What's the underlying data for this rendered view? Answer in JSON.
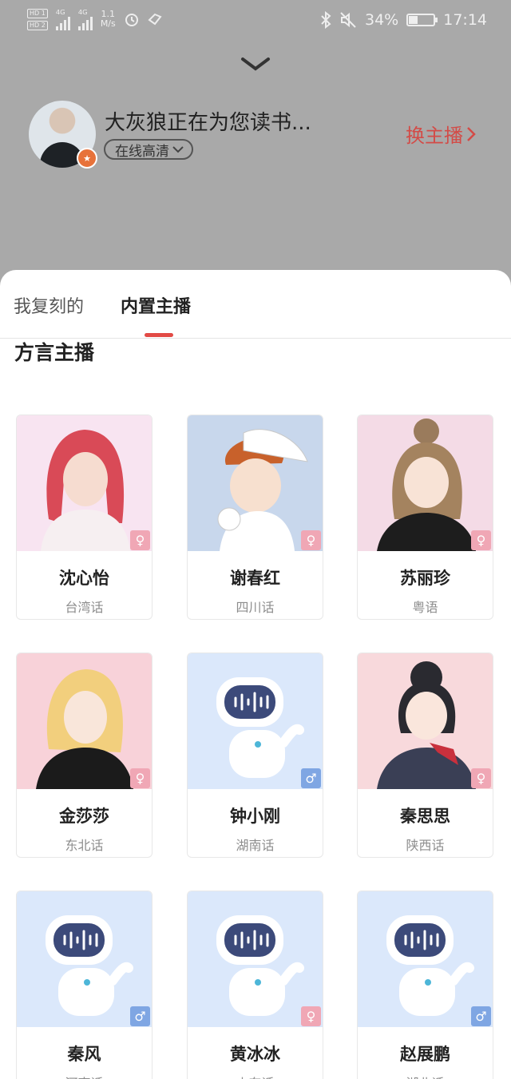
{
  "status_bar": {
    "sim1": "HD 1",
    "sim2": "HD 2",
    "net1": "4G",
    "net2": "4G",
    "speed_value": "1.1",
    "speed_unit": "M/s",
    "battery": "34%",
    "time": "17:14"
  },
  "reader": {
    "title": "大灰狼正在为您读书...",
    "quality": "在线高清",
    "switch_anchor": "换主播"
  },
  "tabs": [
    "我复刻的",
    "内置主播"
  ],
  "active_tab": 1,
  "section": {
    "title": "方言主播"
  },
  "anchors": [
    {
      "name": "沈心怡",
      "dialect": "台湾话",
      "gender": "female",
      "gender_symbol": "♀"
    },
    {
      "name": "谢春红",
      "dialect": "四川话",
      "gender": "female",
      "gender_symbol": "♀"
    },
    {
      "name": "苏丽珍",
      "dialect": "粤语",
      "gender": "female",
      "gender_symbol": "♀"
    },
    {
      "name": "金莎莎",
      "dialect": "东北话",
      "gender": "female",
      "gender_symbol": "♀"
    },
    {
      "name": "钟小刚",
      "dialect": "湖南话",
      "gender": "male",
      "gender_symbol": "♂"
    },
    {
      "name": "秦思思",
      "dialect": "陕西话",
      "gender": "female",
      "gender_symbol": "♀"
    },
    {
      "name": "秦风",
      "dialect": "河南话",
      "gender": "male",
      "gender_symbol": "♂"
    },
    {
      "name": "黄冰冰",
      "dialect": "山东话",
      "gender": "female",
      "gender_symbol": "♀"
    },
    {
      "name": "赵展鹏",
      "dialect": "湖北话",
      "gender": "male",
      "gender_symbol": "♂"
    }
  ],
  "colors": {
    "accent": "#e24a45",
    "switch_text": "#d34b47",
    "female_badge": "#f0a7b5",
    "male_badge": "#7fa6e3",
    "overlay": "#a9a9a9"
  }
}
